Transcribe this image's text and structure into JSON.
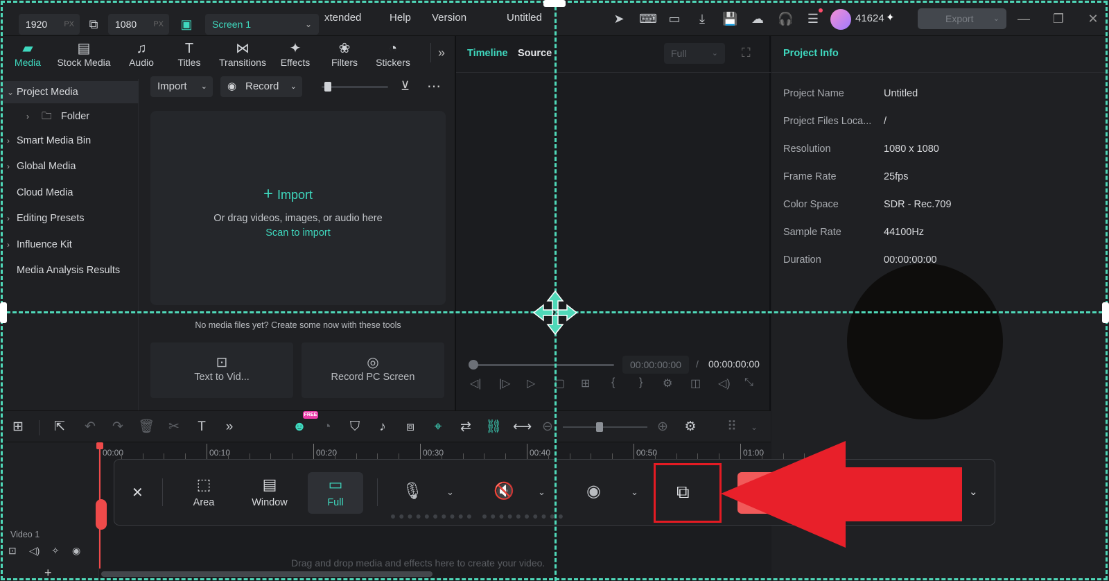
{
  "topbar": {
    "width_value": "1920",
    "height_value": "1080",
    "px_unit": "PX",
    "screen_select": "Screen 1",
    "menu": [
      "xtended",
      "Help",
      "Version"
    ],
    "project_title": "Untitled",
    "user_id": "41624",
    "export_label": "Export"
  },
  "tabs": [
    {
      "label": "Media",
      "icon": "media-icon"
    },
    {
      "label": "Stock Media",
      "icon": "stock-media-icon"
    },
    {
      "label": "Audio",
      "icon": "music-note-icon"
    },
    {
      "label": "Titles",
      "icon": "text-icon"
    },
    {
      "label": "Transitions",
      "icon": "transitions-icon"
    },
    {
      "label": "Effects",
      "icon": "effects-icon"
    },
    {
      "label": "Filters",
      "icon": "filters-icon"
    },
    {
      "label": "Stickers",
      "icon": "stickers-icon"
    }
  ],
  "tree": {
    "project_media": "Project Media",
    "folder": "Folder",
    "smart_media_bin": "Smart Media Bin",
    "global_media": "Global Media",
    "cloud_media": "Cloud Media",
    "editing_presets": "Editing Presets",
    "influence_kit": "Influence Kit",
    "media_analysis": "Media Analysis Results"
  },
  "media": {
    "import_btn": "Import",
    "record_btn": "Record",
    "import_big": "Import",
    "drag_hint": "Or drag videos, images, or audio here",
    "scan_link": "Scan to import",
    "no_media": "No media files yet? Create some now with these tools",
    "tool1": "Text to Vid...",
    "tool2": "Record PC Screen"
  },
  "preview": {
    "tab_timeline": "Timeline",
    "tab_source": "Source",
    "quality": "Full",
    "time_current": "00:00:00:00",
    "time_sep": "/",
    "time_total": "00:00:00:00"
  },
  "project_info": {
    "title": "Project Info",
    "rows": [
      {
        "label": "Project Name",
        "value": "Untitled"
      },
      {
        "label": "Project Files Loca...",
        "value": "/"
      },
      {
        "label": "Resolution",
        "value": "1080 x 1080"
      },
      {
        "label": "Frame Rate",
        "value": "25fps"
      },
      {
        "label": "Color Space",
        "value": "SDR - Rec.709"
      },
      {
        "label": "Sample Rate",
        "value": "44100Hz"
      },
      {
        "label": "Duration",
        "value": "00:00:00:00"
      }
    ]
  },
  "timeline": {
    "free_badge": "FREE",
    "ruler": [
      "00:00",
      "00:10",
      "00:20",
      "00:30",
      "00:40",
      "00:50",
      "01:00"
    ],
    "track_name": "Video 1",
    "drop_hint": "Drag and drop media and effects here to create your video."
  },
  "recorder": {
    "area": "Area",
    "window": "Window",
    "full": "Full"
  },
  "colors": {
    "accent": "#3fd9bf",
    "highlight": "#e41b23",
    "arrow": "#e8202a"
  }
}
